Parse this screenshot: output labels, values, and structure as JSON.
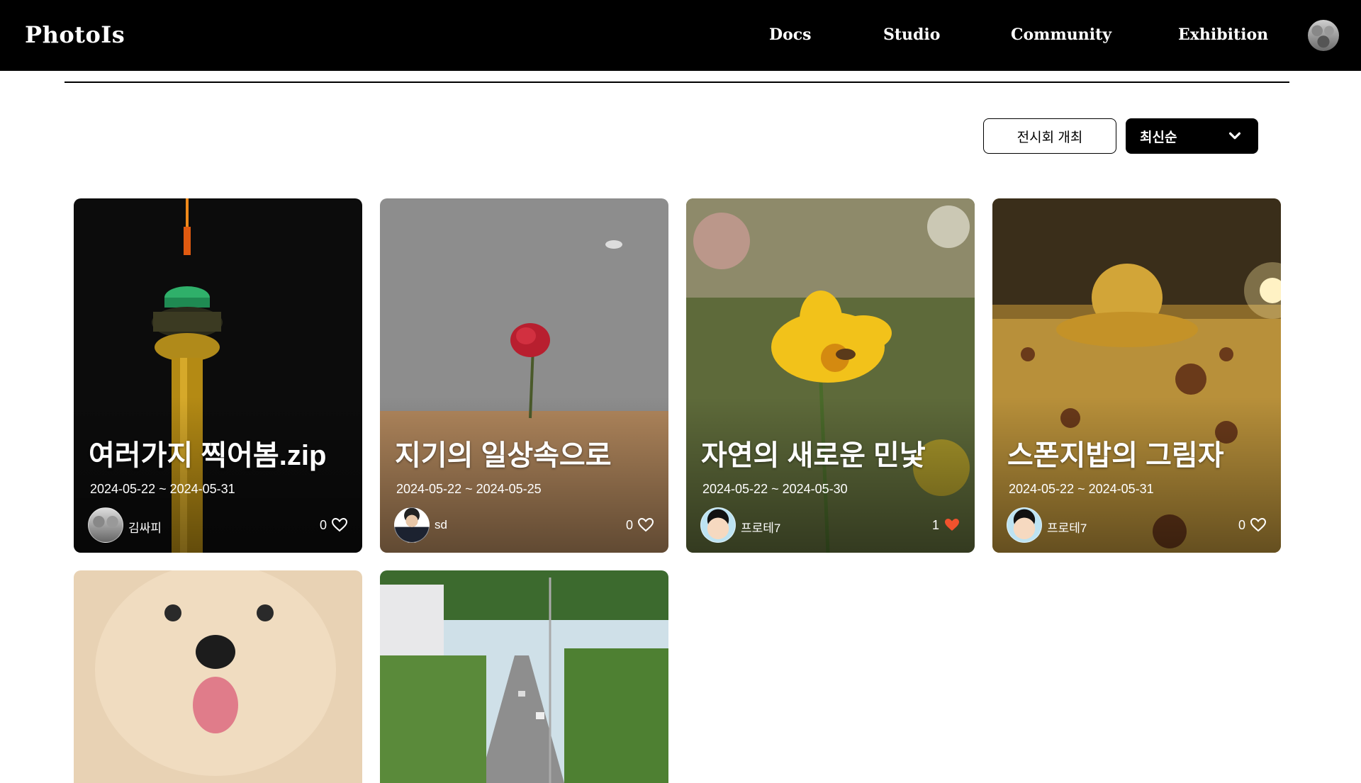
{
  "header": {
    "logo": "PhotoIs",
    "nav": [
      "Docs",
      "Studio",
      "Community",
      "Exhibition"
    ]
  },
  "toolbar": {
    "host_label": "전시회 개최",
    "sort_value": "최신순"
  },
  "cards": [
    {
      "title": "여러가지 찍어봄.zip",
      "dates": "2024-05-22 ~ 2024-05-31",
      "author": "김싸피",
      "likes": "0",
      "liked": false
    },
    {
      "title": "지기의 일상속으로",
      "dates": "2024-05-22 ~ 2024-05-25",
      "author": "sd",
      "likes": "0",
      "liked": false
    },
    {
      "title": "자연의 새로운 민낯",
      "dates": "2024-05-22 ~ 2024-05-30",
      "author": "프로테7",
      "likes": "1",
      "liked": true
    },
    {
      "title": "스폰지밥의 그림자",
      "dates": "2024-05-22 ~ 2024-05-31",
      "author": "프로테7",
      "likes": "0",
      "liked": false
    }
  ],
  "colors": {
    "like_active": "#f0522d",
    "topbar": "#000000"
  }
}
